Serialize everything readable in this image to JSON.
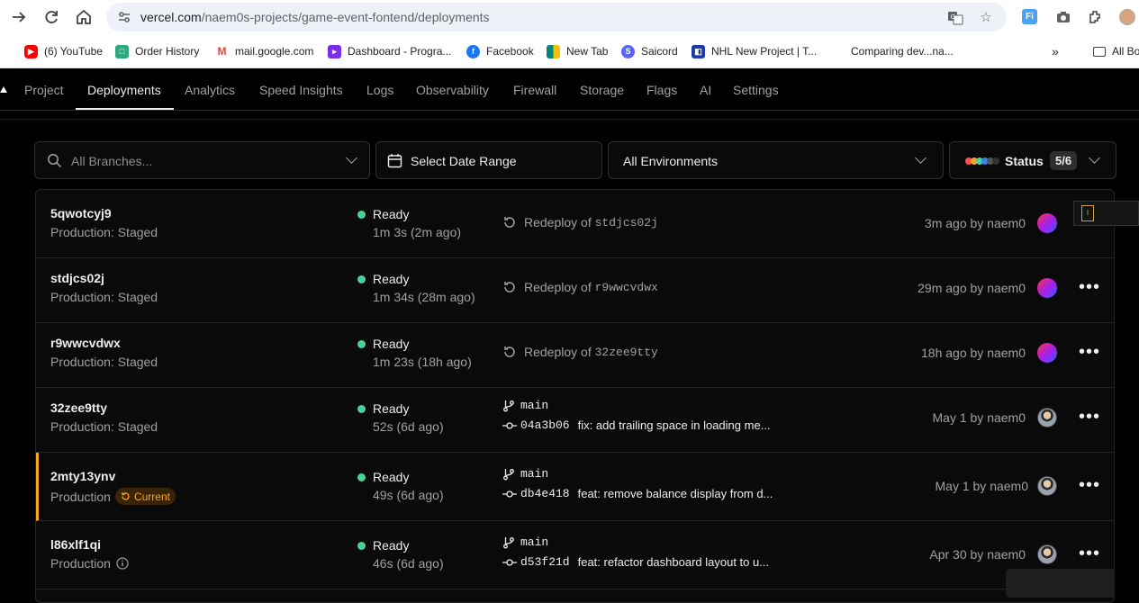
{
  "browser": {
    "url_host": "vercel.com",
    "url_path": "/naem0s-projects/game-event-fontend/deployments",
    "bookmarks": [
      {
        "label": "(6) YouTube",
        "icon": "youtube-icon",
        "color": "#ff0000"
      },
      {
        "label": "Order History",
        "icon": "order-history-icon",
        "color": "#2fa87e"
      },
      {
        "label": "mail.google.com",
        "icon": "gmail-icon",
        "color": "#ea4335"
      },
      {
        "label": "Dashboard - Progra...",
        "icon": "dashboard-icon",
        "color": "#7b2ee6"
      },
      {
        "label": "Facebook",
        "icon": "facebook-icon",
        "color": "#1877f2"
      },
      {
        "label": "New Tab",
        "icon": "meet-icon",
        "color": "#00897b"
      },
      {
        "label": "Saicord",
        "icon": "saicord-icon",
        "color": "#5865f2"
      },
      {
        "label": "NHL New Project | T...",
        "icon": "nhl-icon",
        "color": "#1a3ca8"
      },
      {
        "label": "Comparing dev...na...",
        "icon": "",
        "color": ""
      }
    ],
    "all_bookmarks": "All Bo"
  },
  "nav": {
    "tabs": [
      "Project",
      "Deployments",
      "Analytics",
      "Speed Insights",
      "Logs",
      "Observability",
      "Firewall",
      "Storage",
      "Flags",
      "AI",
      "Settings"
    ],
    "active": "Deployments"
  },
  "filters": {
    "branches_placeholder": "All Branches...",
    "date_range": "Select Date Range",
    "environments": "All Environments",
    "status_label": "Status",
    "status_count": "5/6"
  },
  "deployments": [
    {
      "id": "5qwotcyj9",
      "env": "Production: Staged",
      "status": "Ready",
      "duration": "1m 3s (2m ago)",
      "redeploy_prefix": "Redeploy of",
      "redeploy_of": "stdjcs02j",
      "meta": "3m ago by naem0"
    },
    {
      "id": "stdjcs02j",
      "env": "Production: Staged",
      "status": "Ready",
      "duration": "1m 34s (28m ago)",
      "redeploy_prefix": "Redeploy of",
      "redeploy_of": "r9wwcvdwx",
      "meta": "29m ago by naem0"
    },
    {
      "id": "r9wwcvdwx",
      "env": "Production: Staged",
      "status": "Ready",
      "duration": "1m 23s (18h ago)",
      "redeploy_prefix": "Redeploy of",
      "redeploy_of": "32zee9tty",
      "meta": "18h ago by naem0"
    },
    {
      "id": "32zee9tty",
      "env": "Production: Staged",
      "status": "Ready",
      "duration": "52s (6d ago)",
      "branch": "main",
      "hash": "04a3b06",
      "message": "fix: add trailing space in loading me...",
      "meta": "May 1 by naem0"
    },
    {
      "id": "2mty13ynv",
      "env": "Production",
      "badge": "Current",
      "status": "Ready",
      "duration": "49s (6d ago)",
      "branch": "main",
      "hash": "db4e418",
      "message": "feat: remove balance display from d...",
      "meta": "May 1 by naem0"
    },
    {
      "id": "l86xlf1qi",
      "env": "Production",
      "status": "Ready",
      "duration": "46s (6d ago)",
      "branch": "main",
      "hash": "d53f21d",
      "message": "feat: refactor dashboard layout to u...",
      "meta": "Apr 30 by naem0"
    }
  ],
  "colors": {
    "ready": "#45d49a",
    "current": "#f5a524"
  }
}
